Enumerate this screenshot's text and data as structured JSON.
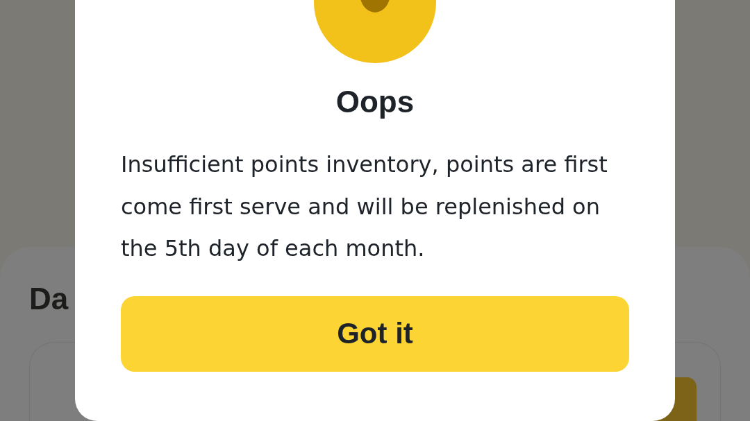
{
  "background": {
    "card_heading": "Da"
  },
  "dialog": {
    "title": "Oops",
    "message": "Insufficient points inventory, points are first come first serve and will be replenished on the 5th day of each month.",
    "button": "Got it"
  }
}
